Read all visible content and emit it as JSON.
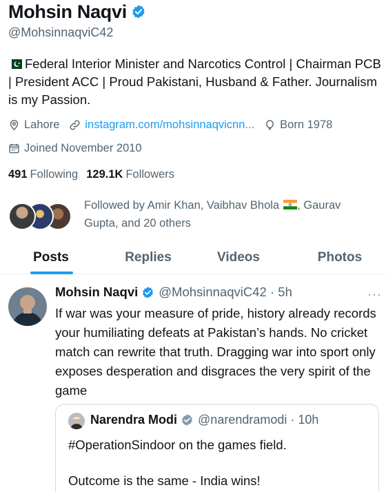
{
  "profile": {
    "name": "Mohsin Naqvi",
    "handle": "@MohsinnaqviC42",
    "bio": "Federal Interior Minister and Narcotics Control | Chairman PCB | President ACC | Proud Pakistani, Husband & Father. Journalism is my Passion.",
    "location": "Lahore",
    "link": "instagram.com/mohsinnaqvicnn...",
    "born": "Born 1978",
    "joined": "Joined November 2010",
    "following_count": "491",
    "following_label": "Following",
    "followers_count": "129.1K",
    "followers_label": "Followers",
    "followed_by_part1": "Followed by Amir Khan, Vaibhav Bhola",
    "followed_by_part2": ", Gaurav Gupta, and 20 others"
  },
  "tabs": [
    {
      "label": "Posts"
    },
    {
      "label": "Replies"
    },
    {
      "label": "Videos"
    },
    {
      "label": "Photos"
    }
  ],
  "tweet": {
    "name": "Mohsin Naqvi",
    "meta": "@MohsinnaqviC42 · 5h",
    "more": "···",
    "text": "If war was your measure of pride, history already records your humiliating defeats at Pakistan’s hands. No cricket match can rewrite that truth. Dragging war into sport only exposes desperation and disgraces the very spirit of the game",
    "quote": {
      "name": "Narendra Modi",
      "meta": "@narendramodi · 10h",
      "line1": "#OperationSindoor on the games field.",
      "line2": "Outcome is the same - India wins!"
    }
  },
  "colors": {
    "accent": "#1d9bf0",
    "secondary_text": "#536471",
    "verified_gray": "#829aab"
  },
  "icons": {
    "verified": "verified-badge-icon",
    "location": "location-pin-icon",
    "link": "link-icon",
    "birthday": "balloon-icon",
    "calendar": "calendar-icon",
    "pakistan_flag": "pakistan-flag-icon",
    "india_flag": "india-flag-icon"
  }
}
